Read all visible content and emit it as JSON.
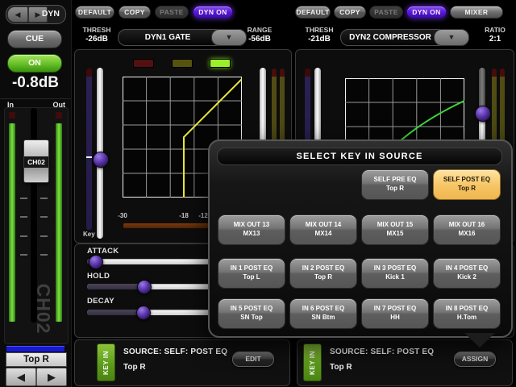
{
  "sidebar": {
    "nav_label": "DYN",
    "prev_icon": "◀",
    "next_icon": "▶",
    "cue_label": "CUE",
    "on_label": "ON",
    "level_readout": "-0.8dB",
    "in_label": "In",
    "out_label": "Out",
    "fader_cap_label": "CH02",
    "channel_watermark": "CH02",
    "channel_name": "Top R",
    "channel_prev_icon": "◀",
    "channel_next_icon": "▶"
  },
  "toolbar_left": {
    "default": "DEFAULT",
    "copy": "COPY",
    "paste": "PASTE",
    "dyn_on": "DYN ON"
  },
  "toolbar_right": {
    "default": "DEFAULT",
    "copy": "COPY",
    "paste": "PASTE",
    "dyn_on": "DYN ON",
    "mixer": "MIXER"
  },
  "dyn1": {
    "thresh_label": "THRESH",
    "thresh_value": "-26dB",
    "type_selected": "DYN1 GATE",
    "dropdown_icon": "▼",
    "range_label": "RANGE",
    "range_value": "-56dB",
    "axis": [
      "-30",
      "-18",
      "-12"
    ],
    "key_label": "Key",
    "sliders": [
      "ATTACK",
      "HOLD",
      "DECAY"
    ],
    "keyin": {
      "tab": "KEY IN",
      "source": "SOURCE:  SELF: POST EQ",
      "name": "Top R",
      "button": "EDIT"
    }
  },
  "dyn2": {
    "thresh_label": "THRESH",
    "thresh_value": "-21dB",
    "type_selected": "DYN2 COMPRESSOR",
    "dropdown_icon": "▼",
    "ratio_label": "RATIO",
    "ratio_value": "2:1",
    "keyin": {
      "tab": "KEY IN",
      "source": "SOURCE:  SELF: POST EQ",
      "name": "Top R",
      "button": "ASSIGN"
    }
  },
  "popup": {
    "title": "SELECT KEY IN SOURCE",
    "buttons": [
      {
        "line1": "SELF PRE EQ",
        "line2": "Top R",
        "selected": false
      },
      {
        "line1": "SELF POST EQ",
        "line2": "Top R",
        "selected": true
      },
      {
        "line1": "MIX OUT 13",
        "line2": "MX13",
        "selected": false
      },
      {
        "line1": "MIX OUT 14",
        "line2": "MX14",
        "selected": false
      },
      {
        "line1": "MIX OUT 15",
        "line2": "MX15",
        "selected": false
      },
      {
        "line1": "MIX OUT 16",
        "line2": "MX16",
        "selected": false
      },
      {
        "line1": "IN 1 POST EQ",
        "line2": "Top L",
        "selected": false
      },
      {
        "line1": "IN 2 POST EQ",
        "line2": "Top R",
        "selected": false
      },
      {
        "line1": "IN 3 POST EQ",
        "line2": "Kick 1",
        "selected": false
      },
      {
        "line1": "IN 4 POST EQ",
        "line2": "Kick 2",
        "selected": false
      },
      {
        "line1": "IN 5 POST EQ",
        "line2": "SN Top",
        "selected": false
      },
      {
        "line1": "IN 6 POST EQ",
        "line2": "SN Btm",
        "selected": false
      },
      {
        "line1": "IN 7 POST EQ",
        "line2": "HH",
        "selected": false
      },
      {
        "line1": "IN 8 POST EQ",
        "line2": "H.Tom",
        "selected": false
      }
    ]
  },
  "colors": {
    "accent_purple": "#5a18d8",
    "selected_amber": "#f5c35e",
    "on_green": "#64c024",
    "keyin_green": "#5d9c1c",
    "meter_green": "#7ce23e",
    "gate_curve_yellow": "#e8e838",
    "comp_curve_green": "#3ed43e",
    "channel_blue": "#1818d0"
  }
}
